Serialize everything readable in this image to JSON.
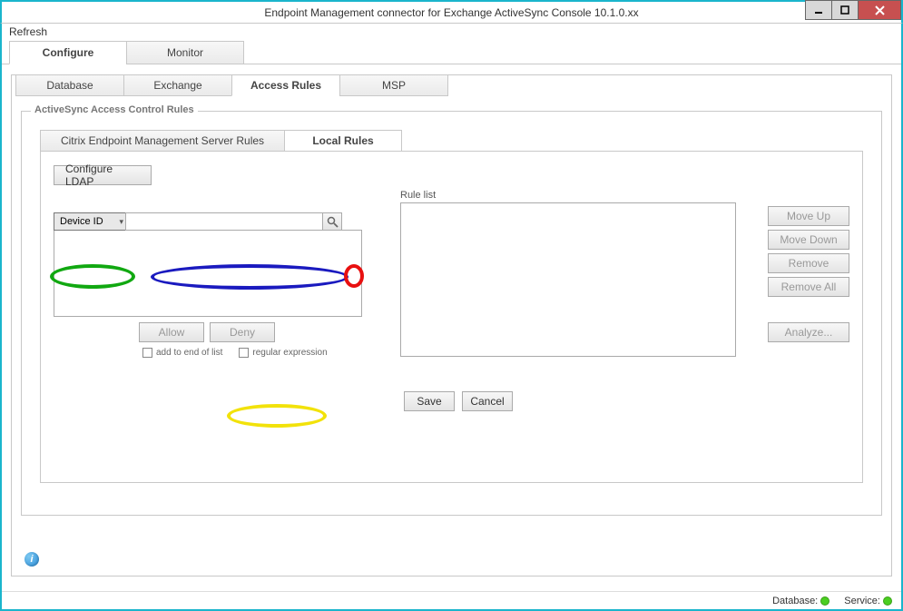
{
  "window": {
    "title": "Endpoint Management connector for Exchange ActiveSync Console 10.1.0.xx"
  },
  "menu": {
    "refresh": "Refresh"
  },
  "primary_tabs": {
    "configure": "Configure",
    "monitor": "Monitor"
  },
  "secondary_tabs": {
    "database": "Database",
    "exchange": "Exchange",
    "access_rules": "Access Rules",
    "msp": "MSP"
  },
  "groupbox": {
    "title": "ActiveSync Access Control Rules"
  },
  "inner_tabs": {
    "server_rules": "Citrix Endpoint Management Server Rules",
    "local_rules": "Local Rules"
  },
  "local_rules": {
    "configure_ldap": "Configure LDAP",
    "scope_dropdown": "Device ID",
    "search_placeholder": "",
    "allow": "Allow",
    "deny": "Deny",
    "add_to_end": "add to end of list",
    "regex": "regular expression",
    "rule_list_label": "Rule list",
    "move_up": "Move Up",
    "move_down": "Move Down",
    "remove": "Remove",
    "remove_all": "Remove All",
    "analyze": "Analyze...",
    "save": "Save",
    "cancel": "Cancel"
  },
  "status": {
    "database_label": "Database:",
    "service_label": "Service:",
    "database_status": "green",
    "service_status": "green"
  },
  "icons": {
    "info": "i"
  }
}
